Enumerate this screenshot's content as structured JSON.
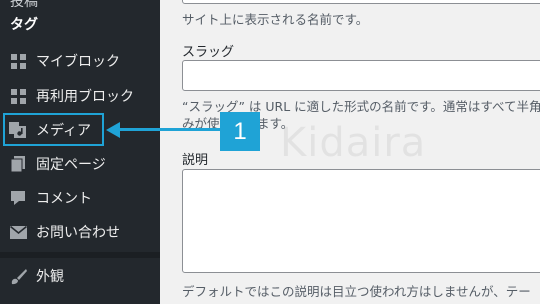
{
  "sidebar": {
    "cut_item_label": "投稿",
    "tag_label": "タグ",
    "items": [
      {
        "label": "マイブロック",
        "icon": "grid-icon"
      },
      {
        "label": "再利用ブロック",
        "icon": "grid-icon"
      },
      {
        "label": "メディア",
        "icon": "media-icon"
      },
      {
        "label": "固定ページ",
        "icon": "pages-icon"
      },
      {
        "label": "コメント",
        "icon": "comment-icon"
      },
      {
        "label": "お問い合わせ",
        "icon": "mail-icon"
      },
      {
        "label": "外観",
        "icon": "brush-icon"
      }
    ]
  },
  "main": {
    "name_help": "サイト上に表示される名前です。",
    "slug_label": "スラッグ",
    "slug_value": "",
    "slug_help_1": "“スラッグ” は URL に適した形式の名前です。通常はすべて半角",
    "slug_help_2": "みが使用されます。",
    "desc_label": "説明",
    "desc_value": "",
    "desc_help": "デフォルトではこの説明は目立つ使われ方はしませんが、テー"
  },
  "watermark": "Kidaira",
  "annotation": {
    "step_number": "1",
    "color": "#1fa3d6"
  }
}
